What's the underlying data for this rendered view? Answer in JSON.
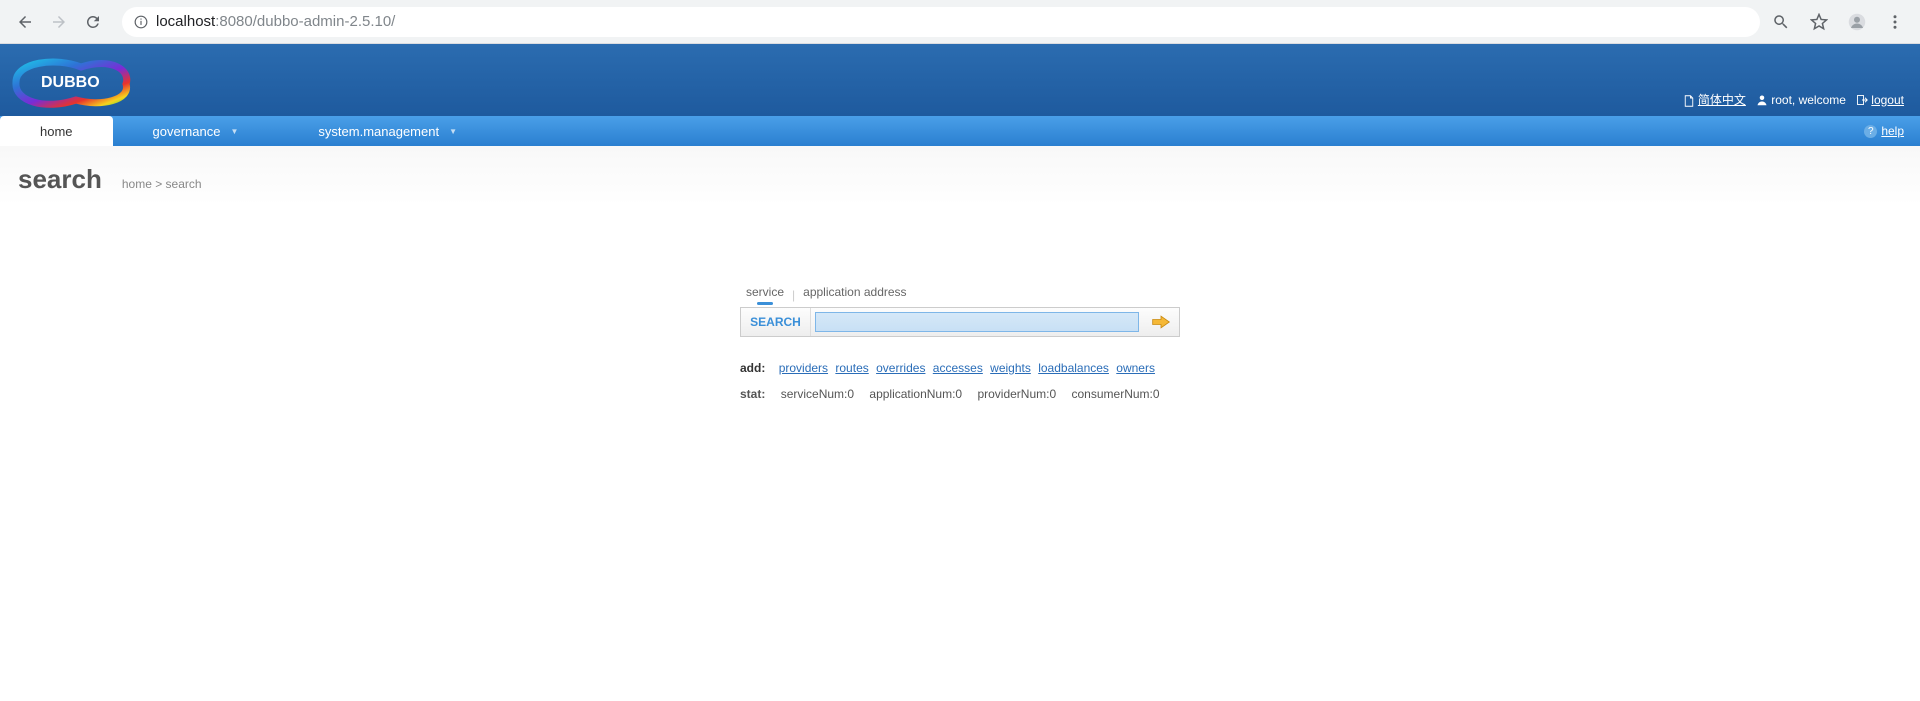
{
  "browser": {
    "url_host": "localhost",
    "url_port": ":8080",
    "url_path": "/dubbo-admin-2.5.10/"
  },
  "header": {
    "logo_text": "DUBBO",
    "lang_link": "简体中文",
    "user_text": "root, welcome",
    "logout": "logout"
  },
  "nav": {
    "home": "home",
    "governance": "governance",
    "system_management": "system.management",
    "help": "help"
  },
  "page": {
    "title": "search",
    "breadcrumb": "home > search"
  },
  "search": {
    "tab_service": "service",
    "tab_app_addr": "application address",
    "label": "SEARCH",
    "value": ""
  },
  "add": {
    "label": "add:",
    "links": {
      "providers": "providers",
      "routes": "routes",
      "overrides": "overrides",
      "accesses": "accesses",
      "weights": "weights",
      "loadbalances": "loadbalances",
      "owners": "owners"
    }
  },
  "stat": {
    "label": "stat:",
    "serviceNum": "serviceNum:0",
    "applicationNum": "applicationNum:0",
    "providerNum": "providerNum:0",
    "consumerNum": "consumerNum:0"
  }
}
